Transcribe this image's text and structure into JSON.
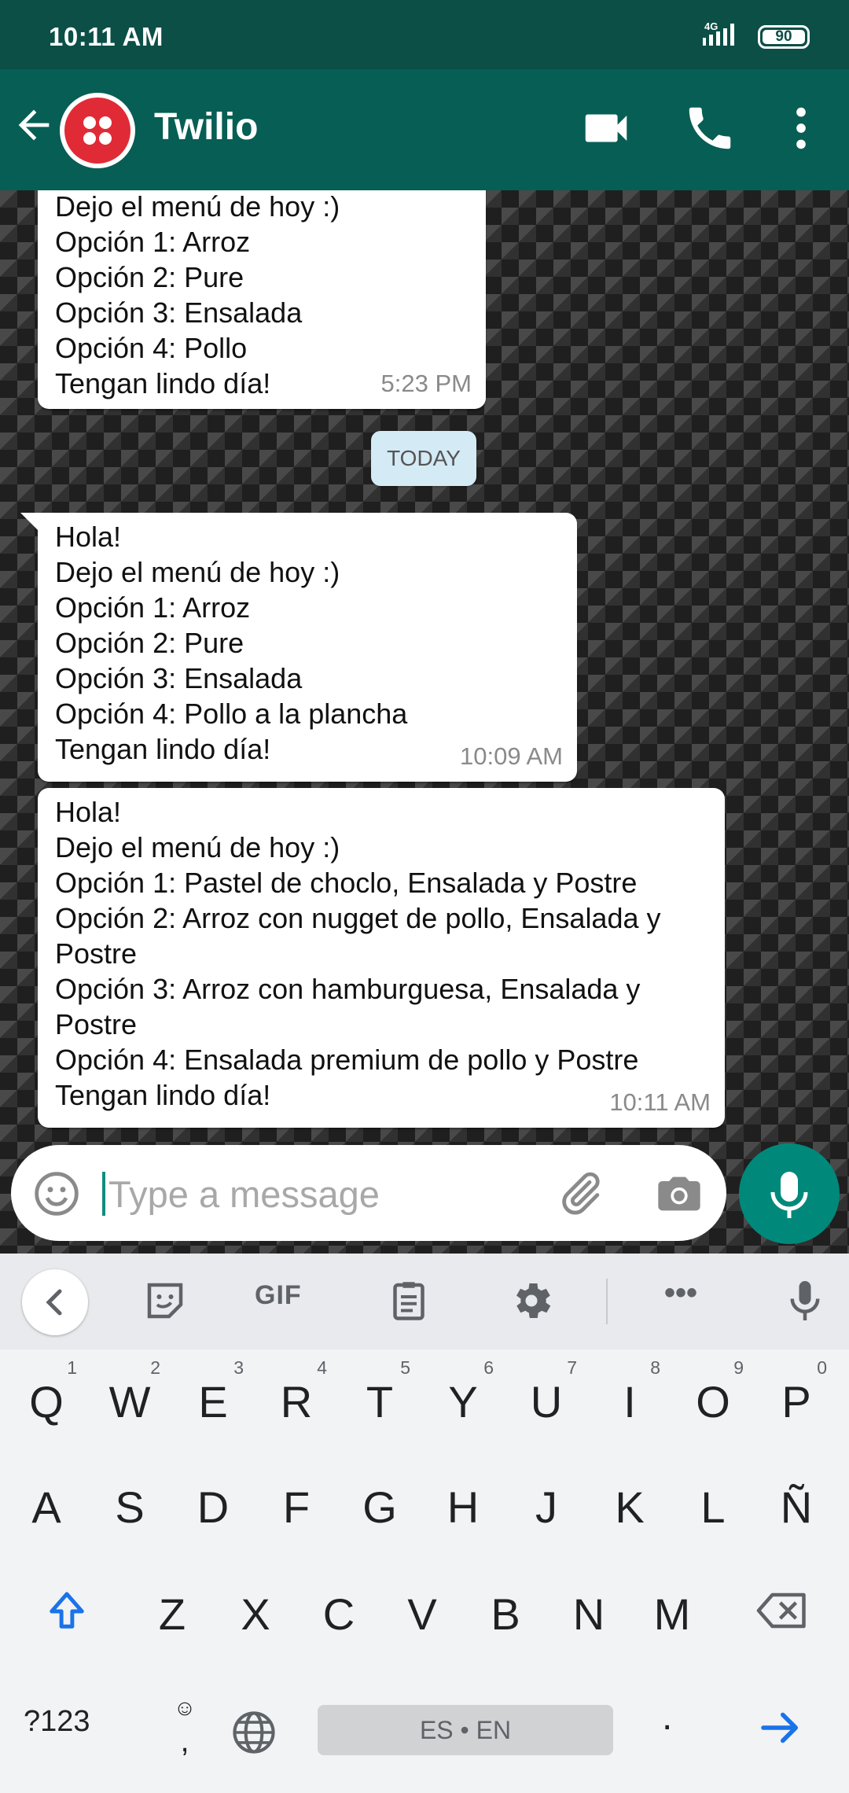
{
  "status_bar": {
    "time": "10:11 AM",
    "network": "4G",
    "battery": "90"
  },
  "header": {
    "contact_name": "Twilio",
    "icons": [
      "back-arrow-icon",
      "video-call-icon",
      "phone-icon",
      "more-vert-icon"
    ]
  },
  "chat": {
    "date_divider": "TODAY",
    "messages": [
      {
        "text": "Dejo el menú de hoy :)\nOpción 1: Arroz\nOpción 2: Pure\nOpción 3: Ensalada\nOpción 4: Pollo\nTengan lindo día!",
        "time": "5:23 PM"
      },
      {
        "text": "Hola!\nDejo el menú de hoy :)\nOpción 1: Arroz\nOpción 2: Pure\nOpción 3: Ensalada\nOpción 4: Pollo a la plancha\nTengan lindo día!",
        "time": "10:09 AM"
      },
      {
        "text": "Hola!\nDejo el menú de hoy :)\nOpción 1: Pastel de choclo, Ensalada y Postre\nOpción 2: Arroz con nugget de pollo, Ensalada y Postre\nOpción 3: Arroz con hamburguesa, Ensalada y Postre\nOpción 4: Ensalada premium de pollo y Postre\nTengan lindo día!",
        "time": "10:11 AM"
      }
    ]
  },
  "composer": {
    "placeholder": "Type a message",
    "value": ""
  },
  "keyboard": {
    "toolbar": {
      "gif_label": "GIF",
      "more_label": "•••"
    },
    "row1": [
      {
        "key": "Q",
        "hint": "1"
      },
      {
        "key": "W",
        "hint": "2"
      },
      {
        "key": "E",
        "hint": "3"
      },
      {
        "key": "R",
        "hint": "4"
      },
      {
        "key": "T",
        "hint": "5"
      },
      {
        "key": "Y",
        "hint": "6"
      },
      {
        "key": "U",
        "hint": "7"
      },
      {
        "key": "I",
        "hint": "8"
      },
      {
        "key": "O",
        "hint": "9"
      },
      {
        "key": "P",
        "hint": "0"
      }
    ],
    "row2": [
      "A",
      "S",
      "D",
      "F",
      "G",
      "H",
      "J",
      "K",
      "L",
      "Ñ"
    ],
    "row3": [
      "Z",
      "X",
      "C",
      "V",
      "B",
      "N",
      "M"
    ],
    "symbols_label": "?123",
    "comma_label": ",",
    "comma_emoji": "☺",
    "space_label": "ES • EN",
    "period_label": "."
  },
  "colors": {
    "header": "#075e54",
    "status_bar": "#0b4f47",
    "accent": "#00897b",
    "bubble": "#ffffff",
    "date_chip": "#d4eaf4"
  }
}
